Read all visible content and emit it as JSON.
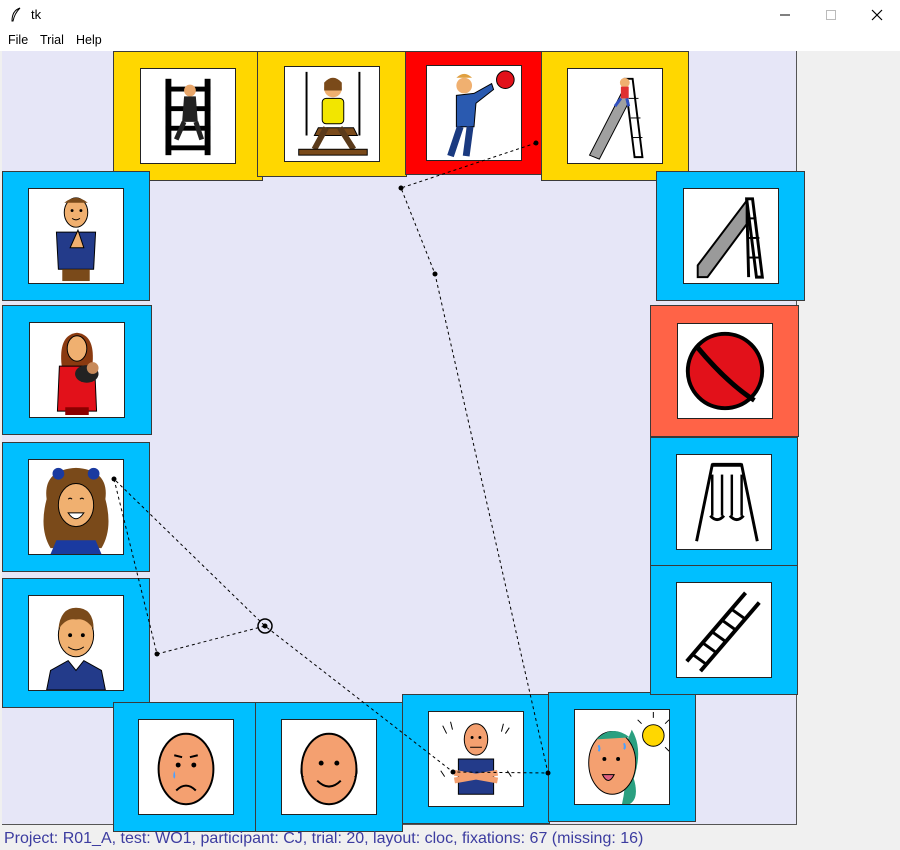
{
  "window": {
    "title": "tk"
  },
  "menu": {
    "file": "File",
    "trial": "Trial",
    "help": "Help"
  },
  "tiles": [
    {
      "pictogram": "climbing-wall",
      "border": "yellow"
    },
    {
      "pictogram": "swing-child",
      "border": "yellow"
    },
    {
      "pictogram": "throwing-ball",
      "border": "red"
    },
    {
      "pictogram": "slide-child",
      "border": "yellow"
    },
    {
      "pictogram": "me-sign",
      "border": "cyan"
    },
    {
      "pictogram": "mother-baby",
      "border": "cyan"
    },
    {
      "pictogram": "girl-curly-hair",
      "border": "cyan"
    },
    {
      "pictogram": "boy",
      "border": "cyan"
    },
    {
      "pictogram": "sad-face",
      "border": "cyan"
    },
    {
      "pictogram": "happy-face",
      "border": "cyan"
    },
    {
      "pictogram": "cold-shivering",
      "border": "cyan"
    },
    {
      "pictogram": "hot-sweating",
      "border": "cyan"
    },
    {
      "pictogram": "slide",
      "border": "cyan"
    },
    {
      "pictogram": "ball",
      "border": "coral"
    },
    {
      "pictogram": "swing-set",
      "border": "cyan"
    },
    {
      "pictogram": "ladder",
      "border": "cyan"
    }
  ],
  "colors": {
    "cyan": "#00bfff",
    "yellow": "#ffd700",
    "red": "#ff0000",
    "coral": "#ff6347",
    "canvas": "#e6e6f7"
  },
  "status": "Project: R01_A, test: WO1, participant: CJ, trial: 20, layout: cloc, fixations: 67 (missing: 16)"
}
